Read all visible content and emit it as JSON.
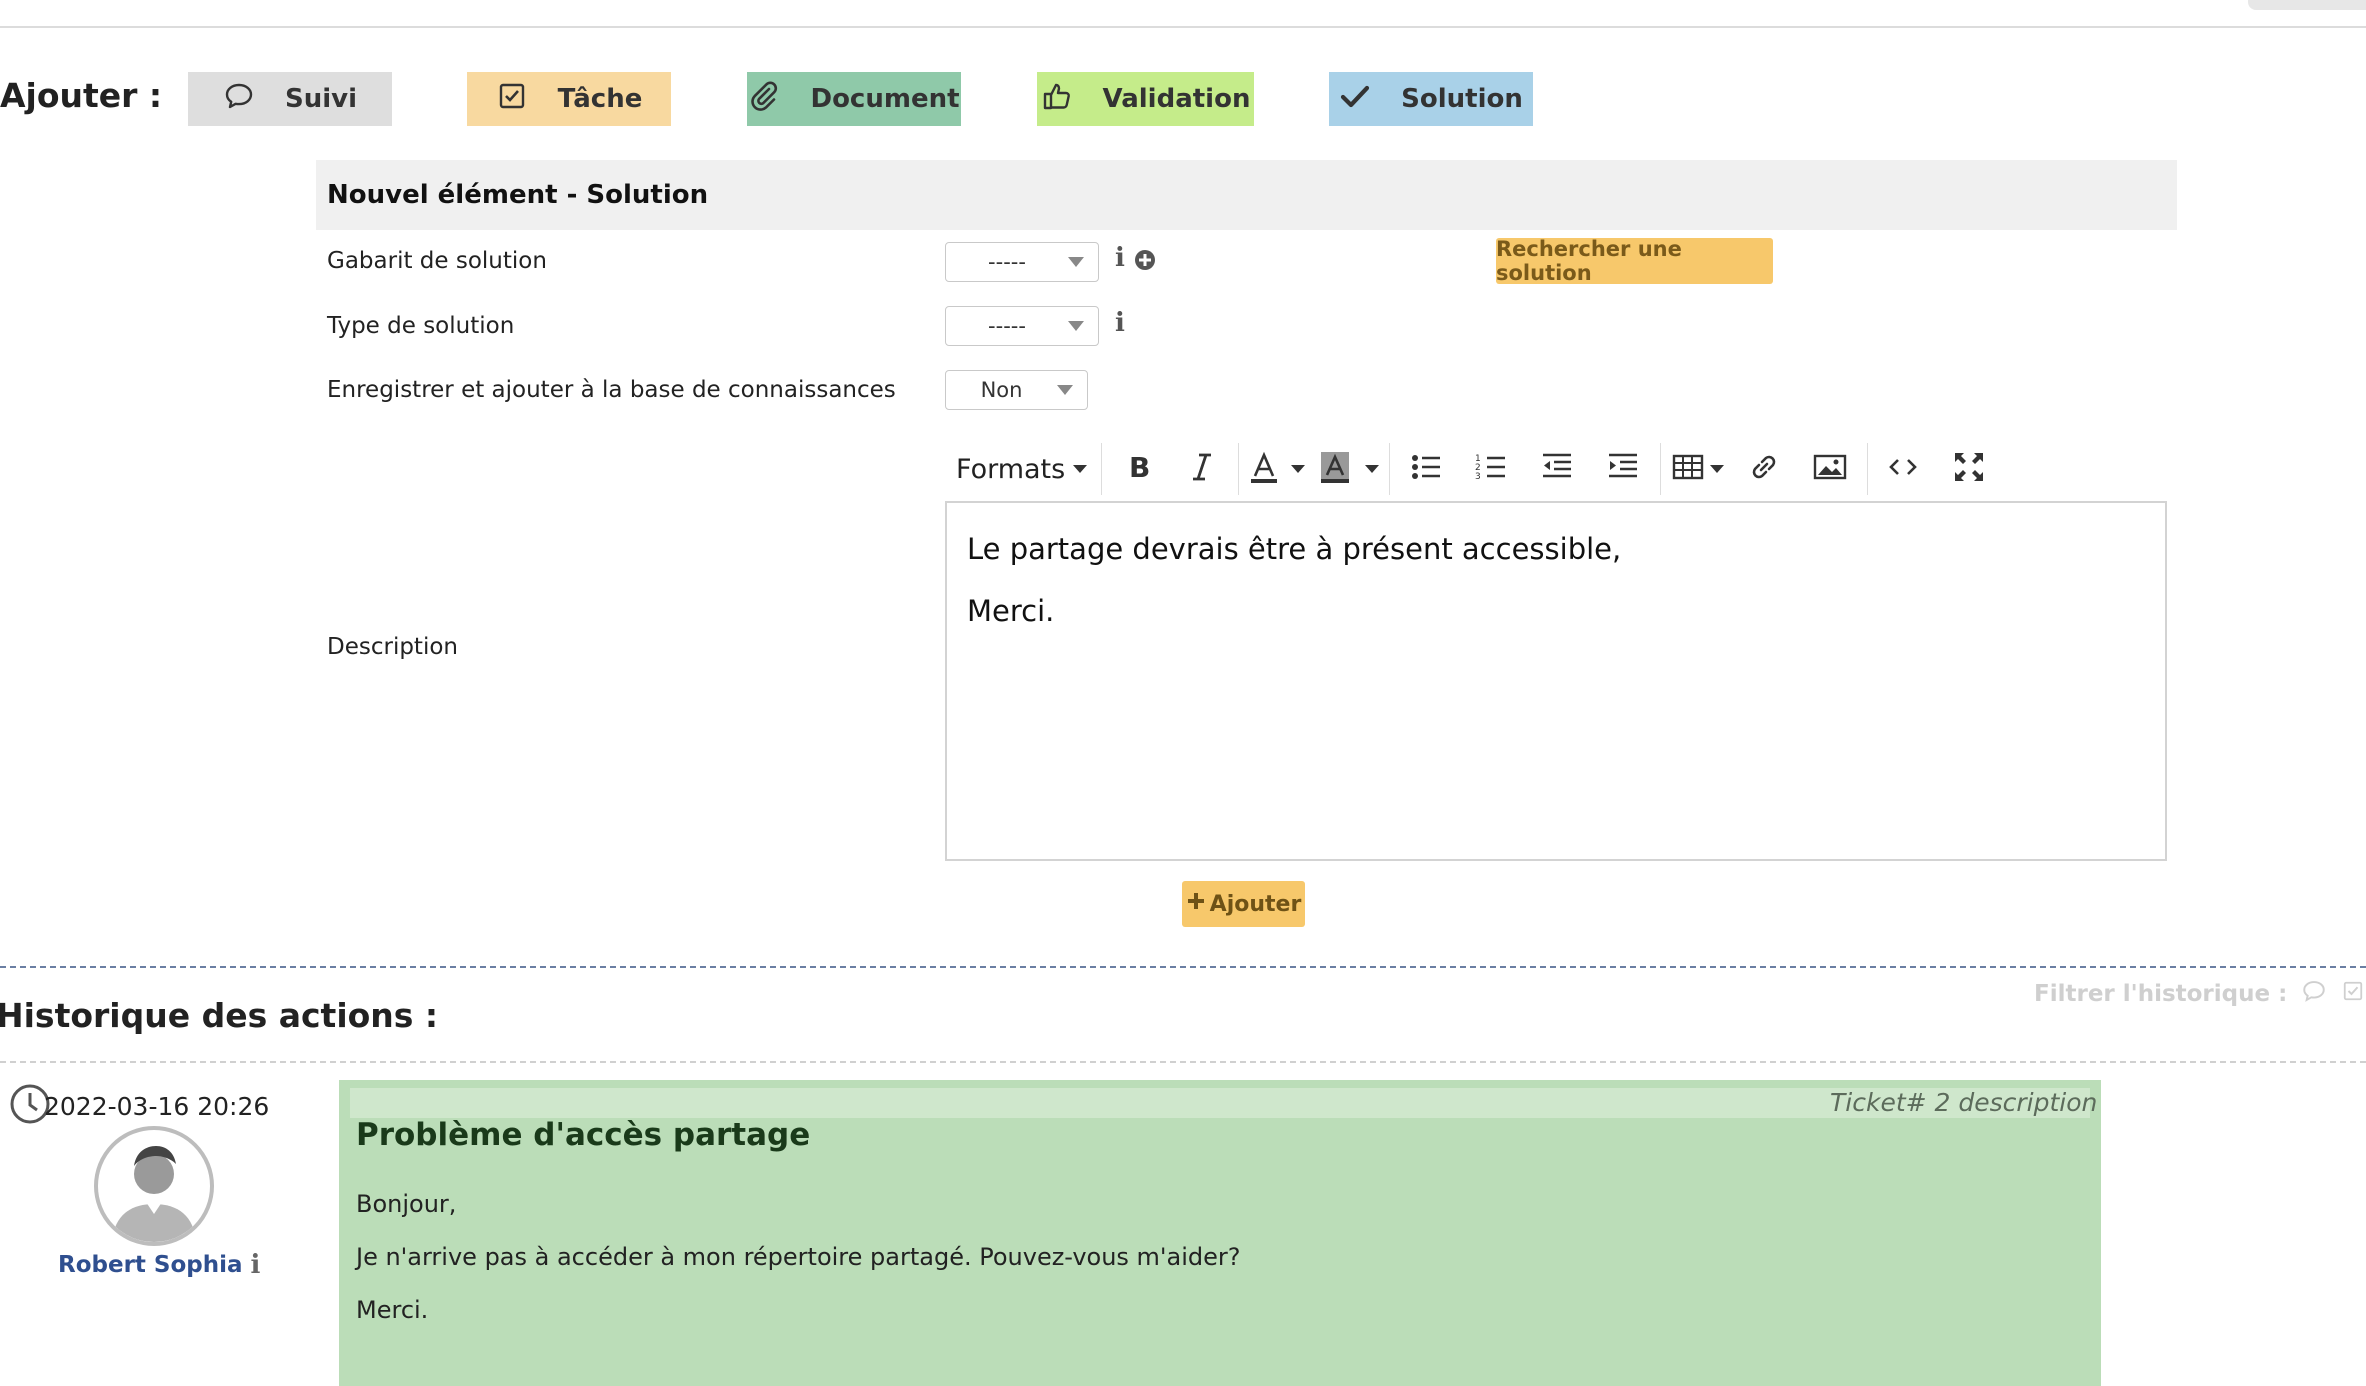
{
  "header": {
    "add_label": "Ajouter :",
    "buttons": [
      {
        "label": "Suivi",
        "icon": "comment-icon",
        "bg": "#dedede"
      },
      {
        "label": "Tâche",
        "icon": "checkbox-icon",
        "bg": "#f8d9a0"
      },
      {
        "label": "Document",
        "icon": "paperclip-icon",
        "bg": "#8fc9a9"
      },
      {
        "label": "Validation",
        "icon": "thumbs-up-icon",
        "bg": "#c5ec8a"
      },
      {
        "label": "Solution",
        "icon": "check-icon",
        "bg": "#a9d1e8"
      }
    ]
  },
  "form": {
    "title": "Nouvel élément - Solution",
    "template_label": "Gabarit de solution",
    "template_value": "-----",
    "search_button": "Rechercher une solution",
    "type_label": "Type de solution",
    "type_value": "-----",
    "kb_label": "Enregistrer et ajouter à la base de connaissances",
    "kb_value": "Non",
    "description_label": "Description",
    "editor": {
      "formats_label": "Formats",
      "lines": [
        "Le partage devrais être à présent accessible,",
        "Merci."
      ]
    },
    "submit_label": "Ajouter"
  },
  "history": {
    "title": "Historique des actions :",
    "filter_label": "Filtrer l'historique :",
    "entry": {
      "timestamp": "2022-03-16 20:26",
      "author": "Robert Sophia",
      "ref": "Ticket# 2 description",
      "title": "Problème d'accès partage",
      "lines": [
        "Bonjour,",
        "Je n'arrive pas à accéder à mon répertoire partagé. Pouvez-vous m'aider?",
        "Merci."
      ]
    }
  },
  "colors": {
    "accent_orange": "#f7c86b",
    "ticket_green": "#bbddb8",
    "author_blue": "#2f4f8f"
  }
}
